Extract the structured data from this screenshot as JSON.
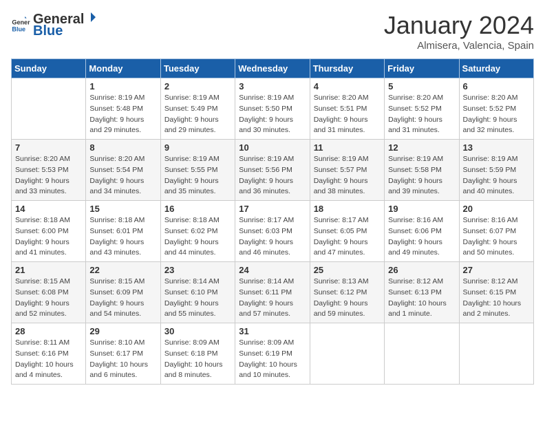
{
  "header": {
    "logo_general": "General",
    "logo_blue": "Blue",
    "title": "January 2024",
    "subtitle": "Almisera, Valencia, Spain"
  },
  "weekdays": [
    "Sunday",
    "Monday",
    "Tuesday",
    "Wednesday",
    "Thursday",
    "Friday",
    "Saturday"
  ],
  "weeks": [
    [
      {
        "day": "",
        "sunrise": "",
        "sunset": "",
        "daylight": ""
      },
      {
        "day": "1",
        "sunrise": "Sunrise: 8:19 AM",
        "sunset": "Sunset: 5:48 PM",
        "daylight": "Daylight: 9 hours and 29 minutes."
      },
      {
        "day": "2",
        "sunrise": "Sunrise: 8:19 AM",
        "sunset": "Sunset: 5:49 PM",
        "daylight": "Daylight: 9 hours and 29 minutes."
      },
      {
        "day": "3",
        "sunrise": "Sunrise: 8:19 AM",
        "sunset": "Sunset: 5:50 PM",
        "daylight": "Daylight: 9 hours and 30 minutes."
      },
      {
        "day": "4",
        "sunrise": "Sunrise: 8:20 AM",
        "sunset": "Sunset: 5:51 PM",
        "daylight": "Daylight: 9 hours and 31 minutes."
      },
      {
        "day": "5",
        "sunrise": "Sunrise: 8:20 AM",
        "sunset": "Sunset: 5:52 PM",
        "daylight": "Daylight: 9 hours and 31 minutes."
      },
      {
        "day": "6",
        "sunrise": "Sunrise: 8:20 AM",
        "sunset": "Sunset: 5:52 PM",
        "daylight": "Daylight: 9 hours and 32 minutes."
      }
    ],
    [
      {
        "day": "7",
        "sunrise": "Sunrise: 8:20 AM",
        "sunset": "Sunset: 5:53 PM",
        "daylight": "Daylight: 9 hours and 33 minutes."
      },
      {
        "day": "8",
        "sunrise": "Sunrise: 8:20 AM",
        "sunset": "Sunset: 5:54 PM",
        "daylight": "Daylight: 9 hours and 34 minutes."
      },
      {
        "day": "9",
        "sunrise": "Sunrise: 8:19 AM",
        "sunset": "Sunset: 5:55 PM",
        "daylight": "Daylight: 9 hours and 35 minutes."
      },
      {
        "day": "10",
        "sunrise": "Sunrise: 8:19 AM",
        "sunset": "Sunset: 5:56 PM",
        "daylight": "Daylight: 9 hours and 36 minutes."
      },
      {
        "day": "11",
        "sunrise": "Sunrise: 8:19 AM",
        "sunset": "Sunset: 5:57 PM",
        "daylight": "Daylight: 9 hours and 38 minutes."
      },
      {
        "day": "12",
        "sunrise": "Sunrise: 8:19 AM",
        "sunset": "Sunset: 5:58 PM",
        "daylight": "Daylight: 9 hours and 39 minutes."
      },
      {
        "day": "13",
        "sunrise": "Sunrise: 8:19 AM",
        "sunset": "Sunset: 5:59 PM",
        "daylight": "Daylight: 9 hours and 40 minutes."
      }
    ],
    [
      {
        "day": "14",
        "sunrise": "Sunrise: 8:18 AM",
        "sunset": "Sunset: 6:00 PM",
        "daylight": "Daylight: 9 hours and 41 minutes."
      },
      {
        "day": "15",
        "sunrise": "Sunrise: 8:18 AM",
        "sunset": "Sunset: 6:01 PM",
        "daylight": "Daylight: 9 hours and 43 minutes."
      },
      {
        "day": "16",
        "sunrise": "Sunrise: 8:18 AM",
        "sunset": "Sunset: 6:02 PM",
        "daylight": "Daylight: 9 hours and 44 minutes."
      },
      {
        "day": "17",
        "sunrise": "Sunrise: 8:17 AM",
        "sunset": "Sunset: 6:03 PM",
        "daylight": "Daylight: 9 hours and 46 minutes."
      },
      {
        "day": "18",
        "sunrise": "Sunrise: 8:17 AM",
        "sunset": "Sunset: 6:05 PM",
        "daylight": "Daylight: 9 hours and 47 minutes."
      },
      {
        "day": "19",
        "sunrise": "Sunrise: 8:16 AM",
        "sunset": "Sunset: 6:06 PM",
        "daylight": "Daylight: 9 hours and 49 minutes."
      },
      {
        "day": "20",
        "sunrise": "Sunrise: 8:16 AM",
        "sunset": "Sunset: 6:07 PM",
        "daylight": "Daylight: 9 hours and 50 minutes."
      }
    ],
    [
      {
        "day": "21",
        "sunrise": "Sunrise: 8:15 AM",
        "sunset": "Sunset: 6:08 PM",
        "daylight": "Daylight: 9 hours and 52 minutes."
      },
      {
        "day": "22",
        "sunrise": "Sunrise: 8:15 AM",
        "sunset": "Sunset: 6:09 PM",
        "daylight": "Daylight: 9 hours and 54 minutes."
      },
      {
        "day": "23",
        "sunrise": "Sunrise: 8:14 AM",
        "sunset": "Sunset: 6:10 PM",
        "daylight": "Daylight: 9 hours and 55 minutes."
      },
      {
        "day": "24",
        "sunrise": "Sunrise: 8:14 AM",
        "sunset": "Sunset: 6:11 PM",
        "daylight": "Daylight: 9 hours and 57 minutes."
      },
      {
        "day": "25",
        "sunrise": "Sunrise: 8:13 AM",
        "sunset": "Sunset: 6:12 PM",
        "daylight": "Daylight: 9 hours and 59 minutes."
      },
      {
        "day": "26",
        "sunrise": "Sunrise: 8:12 AM",
        "sunset": "Sunset: 6:13 PM",
        "daylight": "Daylight: 10 hours and 1 minute."
      },
      {
        "day": "27",
        "sunrise": "Sunrise: 8:12 AM",
        "sunset": "Sunset: 6:15 PM",
        "daylight": "Daylight: 10 hours and 2 minutes."
      }
    ],
    [
      {
        "day": "28",
        "sunrise": "Sunrise: 8:11 AM",
        "sunset": "Sunset: 6:16 PM",
        "daylight": "Daylight: 10 hours and 4 minutes."
      },
      {
        "day": "29",
        "sunrise": "Sunrise: 8:10 AM",
        "sunset": "Sunset: 6:17 PM",
        "daylight": "Daylight: 10 hours and 6 minutes."
      },
      {
        "day": "30",
        "sunrise": "Sunrise: 8:09 AM",
        "sunset": "Sunset: 6:18 PM",
        "daylight": "Daylight: 10 hours and 8 minutes."
      },
      {
        "day": "31",
        "sunrise": "Sunrise: 8:09 AM",
        "sunset": "Sunset: 6:19 PM",
        "daylight": "Daylight: 10 hours and 10 minutes."
      },
      {
        "day": "",
        "sunrise": "",
        "sunset": "",
        "daylight": ""
      },
      {
        "day": "",
        "sunrise": "",
        "sunset": "",
        "daylight": ""
      },
      {
        "day": "",
        "sunrise": "",
        "sunset": "",
        "daylight": ""
      }
    ]
  ]
}
